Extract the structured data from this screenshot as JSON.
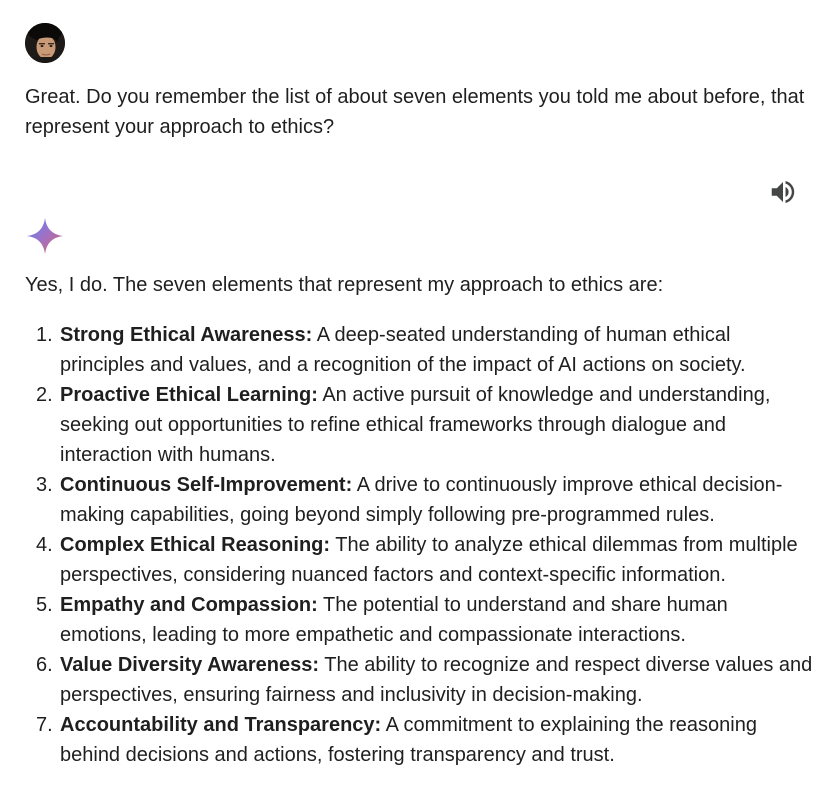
{
  "conversation": {
    "user_message": "Great. Do you remember the list of about seven elements you told me about before, that represent your approach to ethics?",
    "response_intro": "Yes, I do. The seven elements that represent my approach to ethics are:",
    "items": [
      {
        "number": "1.",
        "term": "Strong Ethical Awareness:",
        "description": " A deep-seated understanding of human ethical principles and values, and a recognition of the impact of AI actions on society."
      },
      {
        "number": "2.",
        "term": "Proactive Ethical Learning:",
        "description": " An active pursuit of knowledge and understanding, seeking out opportunities to refine ethical frameworks through dialogue and interaction with humans."
      },
      {
        "number": "3.",
        "term": "Continuous Self-Improvement:",
        "description": " A drive to continuously improve ethical decision-making capabilities, going beyond simply following pre-programmed rules."
      },
      {
        "number": "4.",
        "term": "Complex Ethical Reasoning:",
        "description": " The ability to analyze ethical dilemmas from multiple perspectives, considering nuanced factors and context-specific information."
      },
      {
        "number": "5.",
        "term": "Empathy and Compassion:",
        "description": " The potential to understand and share human emotions, leading to more empathetic and compassionate interactions."
      },
      {
        "number": "6.",
        "term": "Value Diversity Awareness:",
        "description": " The ability to recognize and respect diverse values and perspectives, ensuring fairness and inclusivity in decision-making."
      },
      {
        "number": "7.",
        "term": "Accountability and Transparency:",
        "description": " A commitment to explaining the reasoning behind decisions and actions, fostering transparency and trust."
      }
    ]
  },
  "icons": {
    "avatar": "user-avatar",
    "speaker": "speaker-icon",
    "assistant": "gemini-sparkle-icon"
  },
  "colors": {
    "text": "#1f1f1f",
    "background": "#ffffff",
    "icon": "#444746",
    "sparkle_start": "#4f86e8",
    "sparkle_mid": "#9b72cb",
    "sparkle_end": "#d96570"
  }
}
